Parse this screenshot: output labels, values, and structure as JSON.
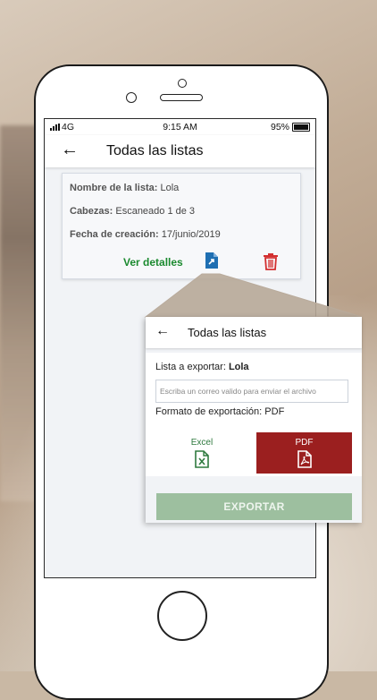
{
  "status_bar": {
    "carrier": "4G",
    "time": "9:15 AM",
    "battery": "95%"
  },
  "header": {
    "back_glyph": "←",
    "title": "Todas las listas"
  },
  "list_card": {
    "name_label": "Nombre de la lista:",
    "name_value": "Lola",
    "heads_label": "Cabezas:",
    "heads_value": "Escaneado 1 de 3",
    "date_label": "Fecha de creación:",
    "date_value": "17/junio/2019",
    "details_link": "Ver detalles"
  },
  "export_dialog": {
    "title": "Todas las listas",
    "export_label": "Lista a exportar:",
    "export_list_name": "Lola",
    "email_placeholder": "Escriba un correo valido para enviar el archivo",
    "format_label": "Formato de exportación: PDF",
    "formats": [
      {
        "label": "Excel",
        "selected": false
      },
      {
        "label": "PDF",
        "selected": true
      }
    ],
    "submit_label": "EXPORTAR"
  },
  "colors": {
    "link_green": "#1b8a2f",
    "pdf_red": "#9b1f1f",
    "delete_red": "#d32f2f",
    "export_blue": "#1f6fb2",
    "submit_disabled_green": "#9dbf9f"
  }
}
